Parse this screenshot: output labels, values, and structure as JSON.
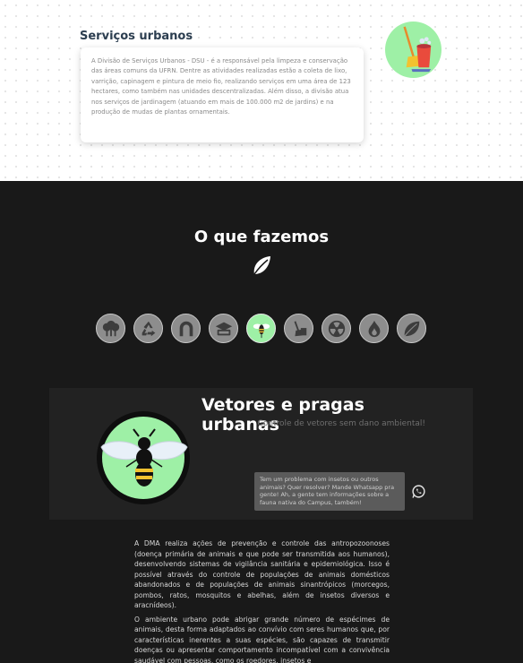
{
  "services": {
    "title": "Serviços urbanos",
    "description": "A Divisão de Serviços Urbanos - DSU - é a responsável pela limpeza e conservação das áreas comuns da UFRN. Dentre as atividades realizadas estão a coleta de lixo, varrição, capinagem e pintura de meio fio, realizando serviços em uma área de 123 hectares, como também nas unidades descentralizadas. Além disso, a divisão atua nos serviços de jardinagem (atuando em mais de 100.000 m2 de jardins) e na produção de mudas de plantas ornamentais.",
    "icon": "cleaning-bucket-icon"
  },
  "what_we_do": {
    "title": "O que fazemos",
    "icon": "leaf-icon",
    "categories": [
      {
        "name": "trees",
        "icon": "trees-icon",
        "active": false
      },
      {
        "name": "recycling",
        "icon": "recycle-icon",
        "active": false
      },
      {
        "name": "water",
        "icon": "water-drop-icon",
        "active": false
      },
      {
        "name": "education",
        "icon": "graduation-cap-icon",
        "active": false
      },
      {
        "name": "vectors",
        "icon": "bee-icon",
        "active": true
      },
      {
        "name": "cleaning",
        "icon": "broom-icon",
        "active": false
      },
      {
        "name": "radiation",
        "icon": "radiation-icon",
        "active": false
      },
      {
        "name": "energy",
        "icon": "flame-icon",
        "active": false
      },
      {
        "name": "plants",
        "icon": "leaf-icon",
        "active": false
      }
    ]
  },
  "feature": {
    "title": "Vetores e pragas urbanas",
    "subtitle": "Controle de vetores sem dano ambiental!",
    "tooltip": "Tem um problema com insetos ou outros animais? Quer resolver? Mande Whatsapp pra gente! Ah, a gente tem informações sobre a fauna nativa do Campus, também!",
    "icon": "bee-icon",
    "contact_icon": "whatsapp-icon"
  },
  "content": {
    "paragraphs": [
      "A DMA realiza ações de prevenção e controle das antropozoonoses (doença primária de animais e que pode ser transmitida aos humanos), desenvolvendo sistemas de vigilância sanitária e epidemiológica. Isso é possível através do controle de populações de animais domésticos abandonados e de populações de animais sinantrópicos (morcegos, pombos, ratos, mosquitos e abelhas, além de insetos diversos e aracnídeos).",
      "O ambiente urbano pode abrigar grande número de espécimes de animais, desta forma adaptados ao convívio com seres humanos que, por características inerentes a suas espécies, são capazes de transmitir doenças ou apresentar comportamento incompatível com a convivência saudável com pessoas, como os roedores, insetos e"
    ]
  },
  "colors": {
    "accent": "#9ef0a6",
    "dark_bg": "#191919",
    "panel_bg": "#222222"
  }
}
